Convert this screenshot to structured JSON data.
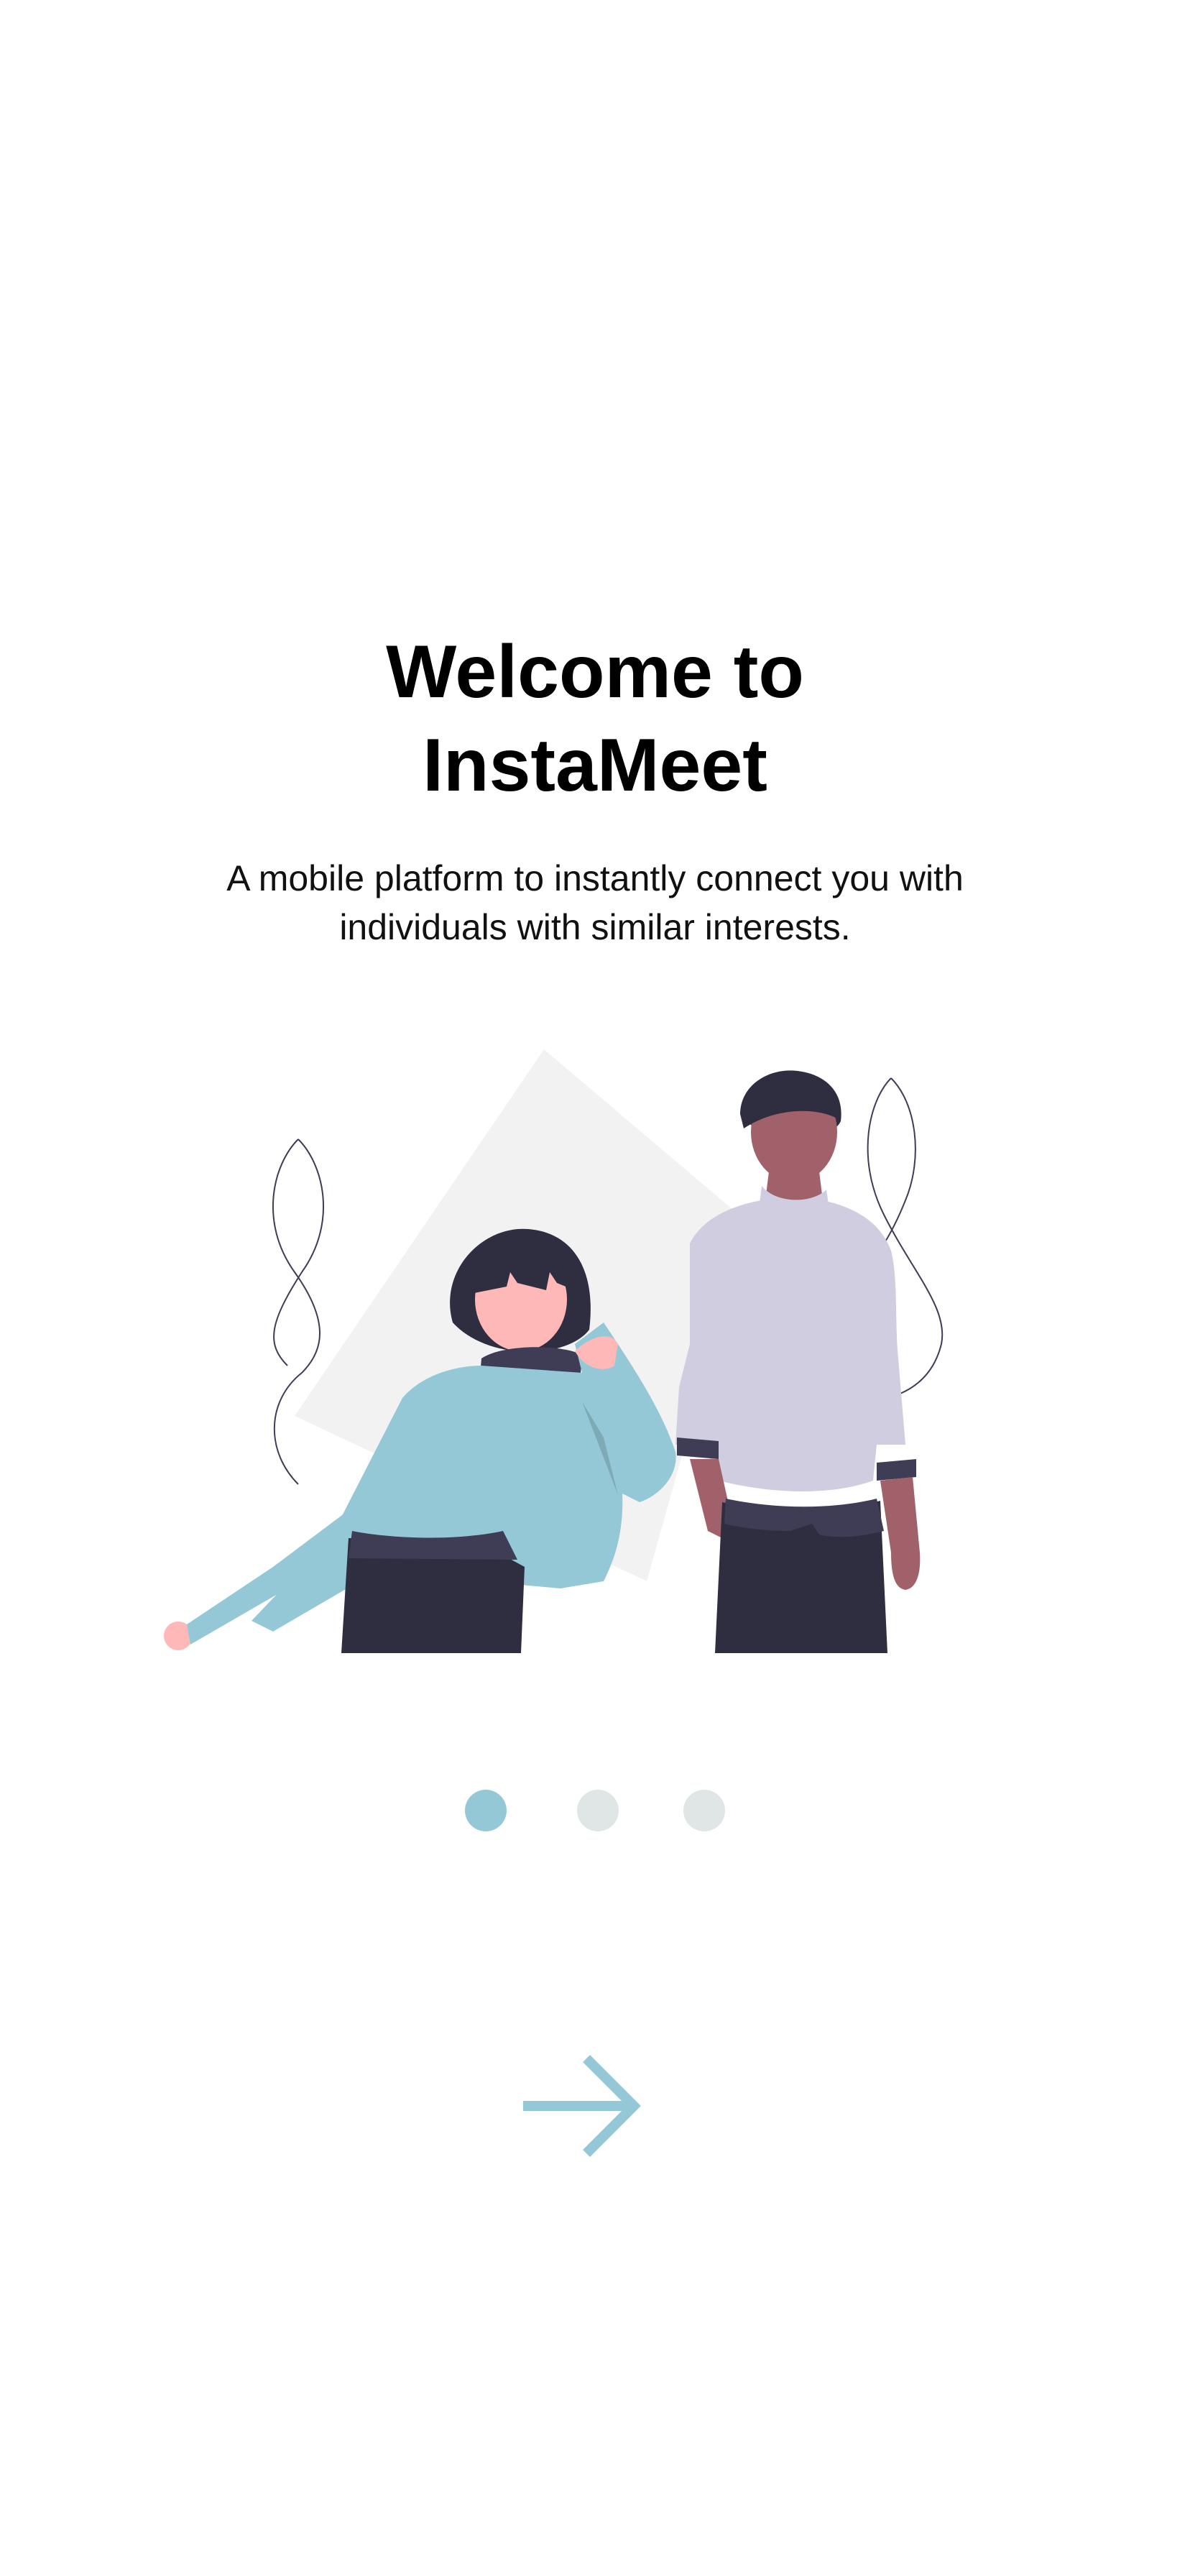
{
  "onboarding": {
    "title_line1": "Welcome to",
    "title_line2": "InstaMeet",
    "subtitle": "A mobile platform to instantly connect you with individuals with similar interests.",
    "illustration": "two-people-meeting-illustration",
    "pagination": {
      "total": 3,
      "active_index": 0,
      "active_color": "#95C8D6",
      "inactive_color": "#E0E5E6"
    },
    "next_icon": "arrow-right-icon",
    "accent_color": "#95C8D6"
  }
}
